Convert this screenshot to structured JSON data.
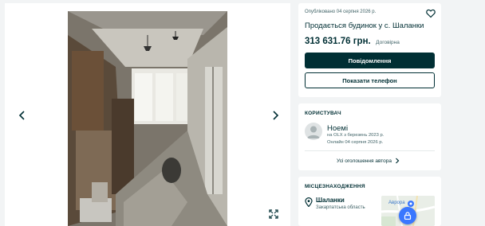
{
  "listing": {
    "posted": "Опубліковано 04 серпня 2026 р.",
    "title": "Продається будинок у с. Шаланки",
    "price": "313 631.76 грн.",
    "price_note": "Договірна",
    "message_button": "Повідомлення",
    "phone_button": "Показати телефон"
  },
  "user": {
    "section_title": "КОРИСТУВАЧ",
    "name": "Ноемі",
    "since": "на OLX з березень 2023 р.",
    "online": "Онлайн 04 серпня 2026 р.",
    "all_ads": "Усі оголошення автора"
  },
  "location": {
    "section_title": "МІСЦЕЗНАХОДЖЕННЯ",
    "city": "Шаланки",
    "region": "Закарпатська область",
    "map_label": "Аврора"
  },
  "icons": {
    "prev": "chevron-left-icon",
    "next": "chevron-right-icon",
    "fullscreen": "expand-icon",
    "favorite": "heart-icon",
    "pin": "location-pin-icon",
    "fab": "lock-icon"
  },
  "colors": {
    "primary": "#002f34",
    "secondary_text": "#406367",
    "background": "#f2f4f5",
    "map_accent": "#3a77ff"
  }
}
